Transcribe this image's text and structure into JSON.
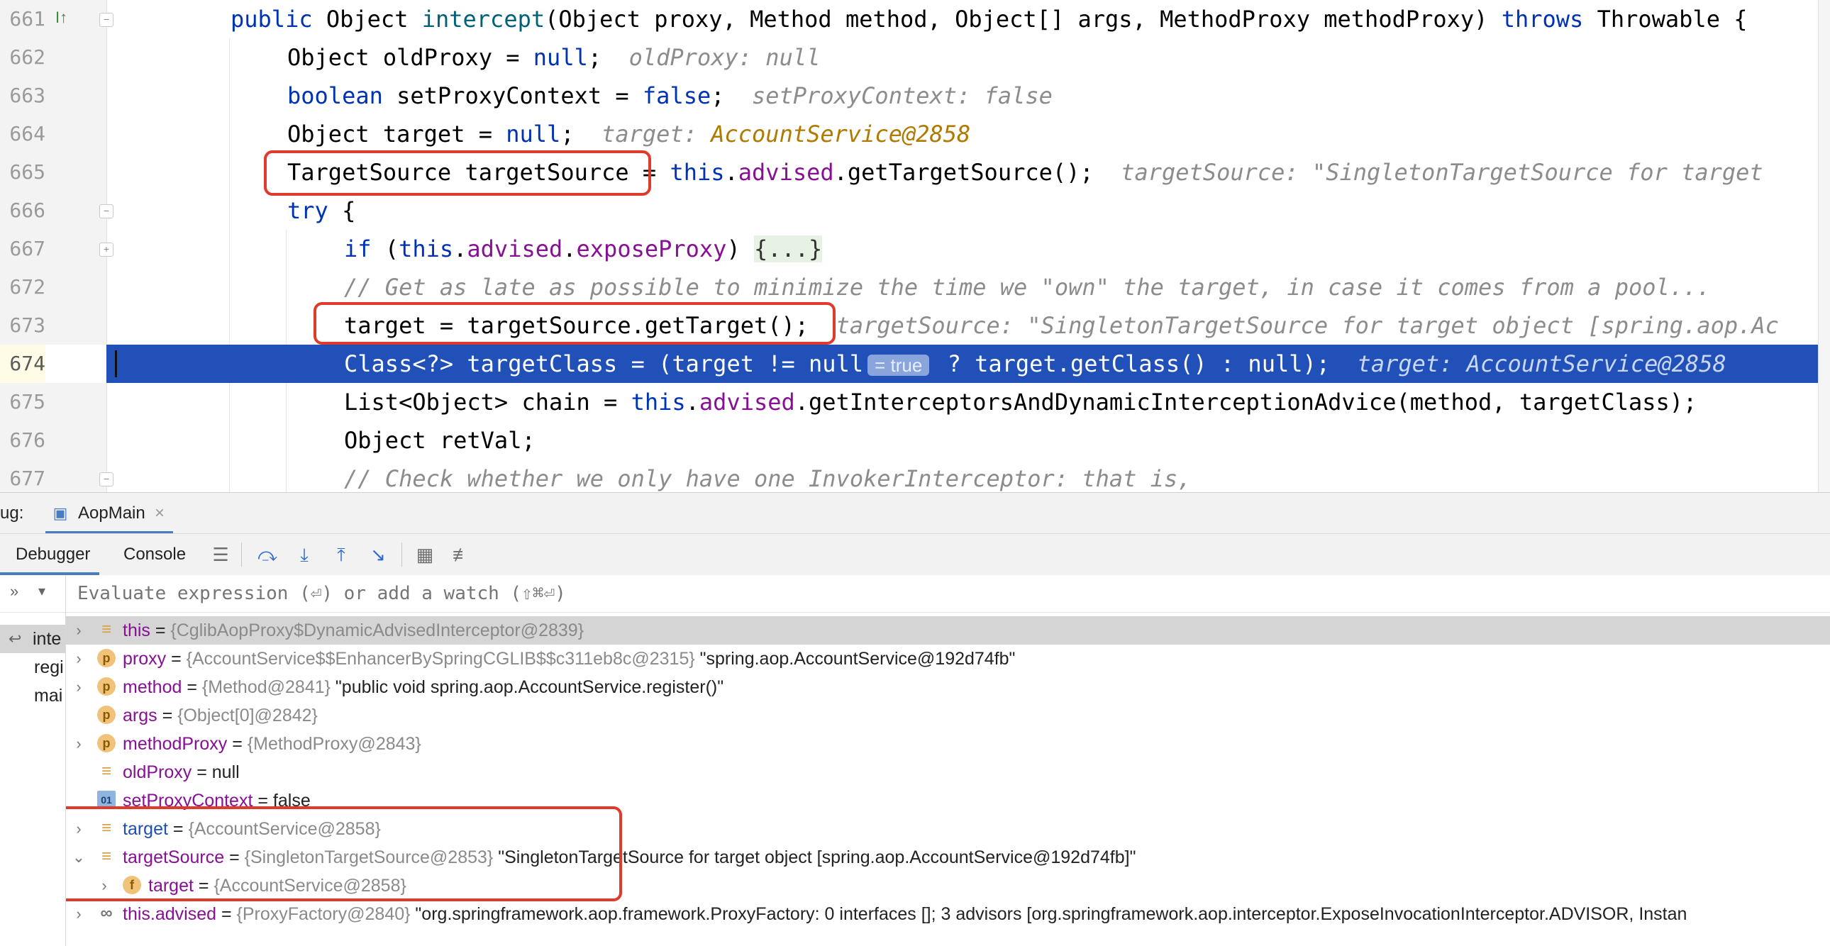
{
  "editor": {
    "lines": [
      {
        "num": "661",
        "tokens": [
          {
            "t": "public ",
            "c": "kw"
          },
          {
            "t": "Object ",
            "c": ""
          },
          {
            "t": "intercept",
            "c": "fn"
          },
          {
            "t": "(Object proxy, Method method, Object[] args, MethodProxy methodProxy) ",
            "c": ""
          },
          {
            "t": "throws ",
            "c": "kw"
          },
          {
            "t": "Throwable {",
            "c": ""
          }
        ]
      },
      {
        "num": "662",
        "tokens": [
          {
            "t": "Object oldProxy = ",
            "c": ""
          },
          {
            "t": "null",
            "c": "kw"
          },
          {
            "t": ";  ",
            "c": ""
          },
          {
            "t": "oldProxy: null",
            "c": "hint"
          }
        ]
      },
      {
        "num": "663",
        "tokens": [
          {
            "t": "boolean ",
            "c": "kw"
          },
          {
            "t": "setProxyContext = ",
            "c": ""
          },
          {
            "t": "false",
            "c": "kw"
          },
          {
            "t": ";  ",
            "c": ""
          },
          {
            "t": "setProxyContext: false",
            "c": "hint"
          }
        ]
      },
      {
        "num": "664",
        "tokens": [
          {
            "t": "Object target = ",
            "c": ""
          },
          {
            "t": "null",
            "c": "kw"
          },
          {
            "t": ";  ",
            "c": ""
          },
          {
            "t": "target: ",
            "c": "hint"
          },
          {
            "t": "AccountService@2858",
            "c": "hint-val"
          }
        ]
      },
      {
        "num": "665",
        "tokens": [
          {
            "t": "TargetSource targetSource = ",
            "c": ""
          },
          {
            "t": "this",
            "c": "kw"
          },
          {
            "t": ".",
            "c": ""
          },
          {
            "t": "advised",
            "c": "fld"
          },
          {
            "t": ".getTargetSource();  ",
            "c": ""
          },
          {
            "t": "targetSource: \"SingletonTargetSource for target",
            "c": "hint"
          }
        ]
      },
      {
        "num": "666",
        "tokens": [
          {
            "t": "try ",
            "c": "kw"
          },
          {
            "t": "{",
            "c": ""
          }
        ]
      },
      {
        "num": "667",
        "tokens": [
          {
            "t": "if ",
            "c": "kw"
          },
          {
            "t": "(",
            "c": ""
          },
          {
            "t": "this",
            "c": "kw"
          },
          {
            "t": ".",
            "c": ""
          },
          {
            "t": "advised",
            "c": "fld"
          },
          {
            "t": ".",
            "c": ""
          },
          {
            "t": "exposeProxy",
            "c": "fld"
          },
          {
            "t": ") ",
            "c": ""
          },
          {
            "t": "{...}",
            "c": "fold"
          }
        ]
      },
      {
        "num": "672",
        "tokens": [
          {
            "t": "// Get as late as possible to minimize the time we \"own\" the target, in case it comes from a pool...",
            "c": "cm"
          }
        ]
      },
      {
        "num": "673",
        "tokens": [
          {
            "t": "target = targetSource.getTarget();  ",
            "c": ""
          },
          {
            "t": "targetSource: \"SingletonTargetSource for target object [spring.aop.Ac",
            "c": "hint"
          }
        ]
      },
      {
        "num": "674",
        "tokens": [
          {
            "t": "Class<?> targetClass = (target != null",
            "c": ""
          },
          {
            "t": "= true",
            "c": "badge"
          },
          {
            "t": " ? target.getClass() : null);  ",
            "c": ""
          },
          {
            "t": "target: AccountService@2858",
            "c": "hint"
          }
        ]
      },
      {
        "num": "675",
        "tokens": [
          {
            "t": "List<Object> chain = ",
            "c": ""
          },
          {
            "t": "this",
            "c": "kw"
          },
          {
            "t": ".",
            "c": ""
          },
          {
            "t": "advised",
            "c": "fld"
          },
          {
            "t": ".getInterceptorsAndDynamicInterceptionAdvice(method, targetClass);",
            "c": ""
          }
        ]
      },
      {
        "num": "676",
        "tokens": [
          {
            "t": "Object retVal;",
            "c": ""
          }
        ]
      },
      {
        "num": "677",
        "tokens": [
          {
            "t": "// Check whether we only have one InvokerInterceptor: that is,",
            "c": "cm"
          }
        ]
      }
    ]
  },
  "debug": {
    "title_prefix": "ug:",
    "run_config": "AopMain",
    "tabs": [
      "Debugger",
      "Console"
    ],
    "watch_placeholder": "Evaluate expression (⏎) or add a watch (⇧⌘⏎)",
    "frames": [
      {
        "label": "inte",
        "selected": true
      },
      {
        "label": "regi",
        "selected": false
      },
      {
        "label": "mai",
        "selected": false
      }
    ],
    "variables": [
      {
        "name": "this",
        "type": "{CglibAopProxy$DynamicAdvisedInterceptor@2839}",
        "value": "",
        "icon": "lines",
        "expand": "closed",
        "selected": true,
        "indent": 0,
        "blue": false
      },
      {
        "name": "proxy",
        "type": "{AccountService$$EnhancerBySpringCGLIB$$c311eb8c@2315}",
        "value": " \"spring.aop.AccountService@192d74fb\"",
        "icon": "p",
        "expand": "closed",
        "selected": false,
        "indent": 0,
        "blue": false
      },
      {
        "name": "method",
        "type": "{Method@2841}",
        "value": " \"public void spring.aop.AccountService.register()\"",
        "icon": "p",
        "expand": "closed",
        "selected": false,
        "indent": 0,
        "blue": false
      },
      {
        "name": "args",
        "type": "{Object[0]@2842}",
        "value": "",
        "icon": "p",
        "expand": "none",
        "selected": false,
        "indent": 0,
        "blue": false
      },
      {
        "name": "methodProxy",
        "type": "{MethodProxy@2843}",
        "value": "",
        "icon": "p",
        "expand": "closed",
        "selected": false,
        "indent": 0,
        "blue": false
      },
      {
        "name": "oldProxy",
        "type": "",
        "value": "null",
        "icon": "lines",
        "expand": "none",
        "selected": false,
        "indent": 0,
        "blue": false
      },
      {
        "name": "setProxyContext",
        "type": "",
        "value": "false",
        "icon": "bool",
        "expand": "none",
        "selected": false,
        "indent": 0,
        "blue": false
      },
      {
        "name": "target",
        "type": "{AccountService@2858}",
        "value": "",
        "icon": "lines",
        "expand": "closed",
        "selected": false,
        "indent": 0,
        "blue": true
      },
      {
        "name": "targetSource",
        "type": "{SingletonTargetSource@2853}",
        "value": " \"SingletonTargetSource for target object [spring.aop.AccountService@192d74fb]\"",
        "icon": "lines",
        "expand": "open",
        "selected": false,
        "indent": 0,
        "blue": false
      },
      {
        "name": "target",
        "type": "{AccountService@2858}",
        "value": "",
        "icon": "f",
        "expand": "closed",
        "selected": false,
        "indent": 1,
        "blue": false
      },
      {
        "name": "this.advised",
        "type": "{ProxyFactory@2840}",
        "value": " \"org.springframework.aop.framework.ProxyFactory: 0 interfaces []; 3 advisors [org.springframework.aop.interceptor.ExposeInvocationInterceptor.ADVISOR, Instan",
        "icon": "oo",
        "expand": "closed",
        "selected": false,
        "indent": 0,
        "blue": false
      }
    ]
  },
  "icons": {
    "gutter_marker": "implementing-method-icon",
    "toolbar": [
      "layout-icon",
      "step-over-icon",
      "step-into-icon",
      "step-out-icon",
      "run-to-cursor-icon",
      "evaluate-icon",
      "trace-icon"
    ]
  },
  "colors": {
    "keyword": "#0033b3",
    "field": "#871094",
    "current_line": "#2050b8",
    "highlight_box": "#e03a2c"
  }
}
